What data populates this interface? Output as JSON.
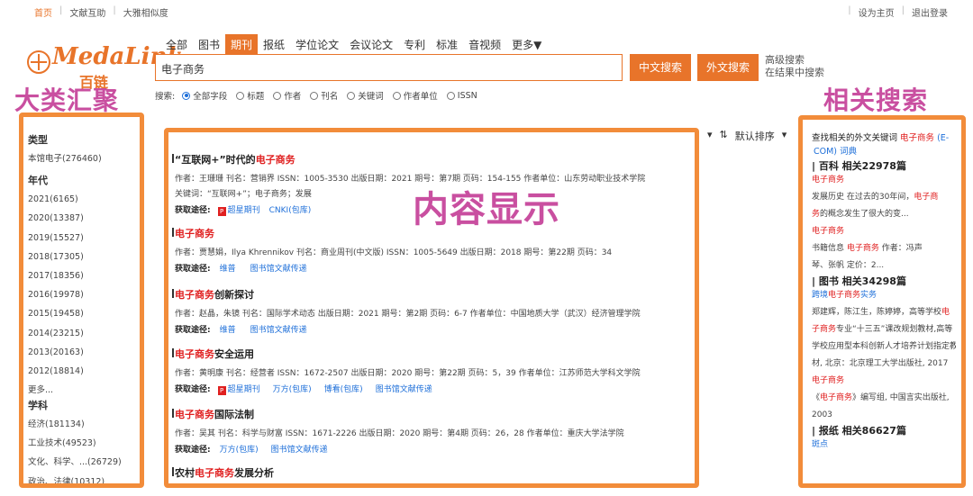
{
  "topbar": {
    "left_links": [
      "首页",
      "文献互助",
      "大雅相似度"
    ],
    "right_links": [
      "设为主页",
      "退出登录"
    ]
  },
  "logo": {
    "name": "MedaLink",
    "cn": "百链"
  },
  "nav_tabs": [
    "全部",
    "图书",
    "期刊",
    "报纸",
    "学位论文",
    "会议论文",
    "专利",
    "标准",
    "音视频",
    "更多▼"
  ],
  "active_tab": "期刊",
  "search": {
    "value": "电子商务",
    "btn_cn": "中文搜索",
    "btn_en": "外文搜索",
    "advanced": "高级搜索",
    "in_results": "在结果中搜索",
    "field_label": "搜索:",
    "fields": [
      "全部字段",
      "标题",
      "作者",
      "刊名",
      "关键词",
      "作者单位",
      "ISSN"
    ],
    "selected_field": "全部字段"
  },
  "annotations": {
    "left": "大类汇聚",
    "center": "内容显示",
    "right": "相关搜索"
  },
  "sidebar": {
    "type_head": "类型",
    "type_items": [
      "本馆电子(276460)"
    ],
    "year_head": "年代",
    "year_items": [
      "2021(6165)",
      "2020(13387)",
      "2019(15527)",
      "2018(17305)",
      "2017(18356)",
      "2016(19978)",
      "2015(19458)",
      "2014(23215)",
      "2013(20163)",
      "2012(18814)",
      "更多..."
    ],
    "subject_head": "学科",
    "subject_items": [
      "经济(181134)",
      "工业技术(49523)",
      "文化、科学、...(26729)",
      "政治、法律(10312)"
    ]
  },
  "sort": {
    "label": "默认排序",
    "icon": "sort-icon"
  },
  "results": [
    {
      "title_pre": "“互联网+”时代的",
      "title_hl": "电子商务",
      "title_post": "",
      "meta": "作者：王珊珊   刊名：营销界   ISSN：1005-3530   出版日期：2021   期号：第7期   页码：154-155   作者单位：山东劳动职业技术学院",
      "keywords": "关键词：“互联网+”；电子商务；发展",
      "source_label": "获取途径:",
      "links": [
        "超星期刊",
        "CNKI(包库)"
      ],
      "pdf": true
    },
    {
      "title_pre": "",
      "title_hl": "电子商务",
      "title_post": "",
      "meta": "作者：贾慧娟，Ilya Khrennikov   刊名：商业周刊(中文版)   ISSN：1005-5649   出版日期：2018   期号：第22期   页码：34",
      "keywords": "",
      "source_label": "获取途径:",
      "links": [
        "维普",
        "图书馆文献传递"
      ],
      "pdf": false
    },
    {
      "title_pre": "",
      "title_hl": "电子商务",
      "title_post": "创新探讨",
      "meta": "作者：赵晶，朱镜   刊名：国际学术动态   出版日期：2021   期号：第2期   页码：6-7   作者单位：中国地质大学（武汉）经济管理学院",
      "keywords": "",
      "source_label": "获取途径:",
      "links": [
        "维普",
        "图书馆文献传递"
      ],
      "pdf": false
    },
    {
      "title_pre": "",
      "title_hl": "电子商务",
      "title_post": "安全运用",
      "meta": "作者：黄明康   刊名：经营者   ISSN：1672-2507   出版日期：2020   期号：第22期   页码：5，39   作者单位：江苏师范大学科文学院",
      "keywords": "",
      "source_label": "获取途径:",
      "links": [
        "超星期刊",
        "万方(包库)",
        "博看(包库)",
        "图书馆文献传递"
      ],
      "pdf": true
    },
    {
      "title_pre": "",
      "title_hl": "电子商务",
      "title_post": "国际法制",
      "meta": "作者：吴其   刊名：科学与财富   ISSN：1671-2226   出版日期：2020   期号：第4期   页码：26，28   作者单位：重庆大学法学院",
      "keywords": "",
      "source_label": "获取途径:",
      "links": [
        "万方(包库)",
        "图书馆文献传递"
      ],
      "pdf": false
    },
    {
      "title_pre": "农村",
      "title_hl": "电子商务",
      "title_post": "发展分析",
      "meta": "",
      "keywords": "",
      "source_label": "",
      "links": [],
      "pdf": false
    }
  ],
  "right": {
    "intro_pre": "查找相关的外文关键词",
    "intro_kw": "电子商务",
    "intro_post": "(E-",
    "intro_line2_blue": "COM)",
    "intro_line2_link": "词典",
    "sec_wiki": "| 百科  相关22978篇",
    "wiki_rows": [
      {
        "kind": "red",
        "text": "电子商务"
      },
      {
        "kind": "mix",
        "parts": [
          [
            "",
            "发展历史        在过去的30年间，"
          ],
          [
            "red",
            "电子商"
          ]
        ]
      },
      {
        "kind": "mix",
        "parts": [
          [
            "red",
            "务"
          ],
          [
            "",
            "的概念发生了很大的变..."
          ]
        ]
      },
      {
        "kind": "red",
        "text": "电子商务"
      },
      {
        "kind": "mix",
        "parts": [
          [
            "",
            "书籍信息      "
          ],
          [
            "red",
            "电子商务"
          ],
          [
            "",
            "      作者：冯声"
          ]
        ]
      },
      {
        "kind": "plain",
        "text": "琴、张帆        定价：2..."
      }
    ],
    "sec_book": "| 图书  相关34298篇",
    "book_rows": [
      {
        "kind": "mix",
        "parts": [
          [
            "blue",
            "跨境"
          ],
          [
            "red",
            "电子商务"
          ],
          [
            "blue",
            "实务"
          ]
        ]
      },
      {
        "kind": "mix",
        "parts": [
          [
            "",
            "郑建辉，陈江生，陈婷婷，高等学校"
          ],
          [
            "red",
            "电"
          ]
        ]
      },
      {
        "kind": "mix",
        "parts": [
          [
            "red",
            "子商务"
          ],
          [
            "",
            "专业“十三五”课改规划教材,高等"
          ]
        ]
      },
      {
        "kind": "plain",
        "text": "学校应用型本科创新人才培养计划指定教"
      },
      {
        "kind": "plain",
        "text": "材, 北京：北京理工大学出版社, 2017"
      },
      {
        "kind": "red",
        "text": "电子商务"
      },
      {
        "kind": "mix",
        "parts": [
          [
            "",
            "《"
          ],
          [
            "red",
            "电子商务"
          ],
          [
            "",
            "》编写组, 中国言实出版社,"
          ]
        ]
      },
      {
        "kind": "plain",
        "text": "2003"
      }
    ],
    "sec_news": "| 报纸  相关86627篇",
    "news_rows": [
      {
        "kind": "blue",
        "text": "斑点"
      }
    ]
  },
  "colors": {
    "accent": "#e8742a",
    "frame": "#f28c3a",
    "annotation": "#c94fa0",
    "highlight": "#e02020",
    "link": "#1e6fd9"
  }
}
